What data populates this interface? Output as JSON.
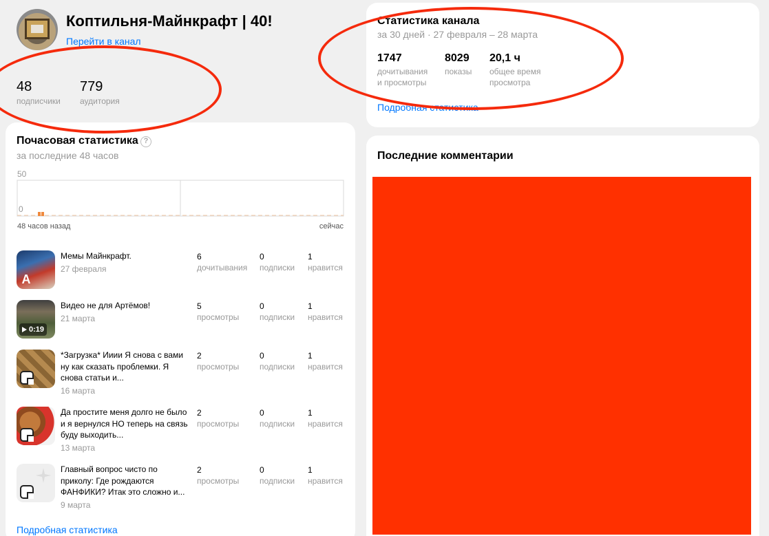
{
  "colors": {
    "accent": "#0077ff",
    "redaction": "#ff3000",
    "annotation": "#f52a0c",
    "chart_bar": "#f08a3e"
  },
  "header": {
    "channel_name": "Коптильня-Майнкрафт | 40!",
    "channel_link": "Перейти в канал",
    "subscribers": {
      "value": "48",
      "label": "подписчики"
    },
    "audience": {
      "value": "779",
      "label": "аудитория"
    }
  },
  "channel_stats": {
    "title": "Статистика канала",
    "period": "за 30 дней · 27 февраля – 28 марта",
    "items": [
      {
        "value": "1747",
        "label_line1": "дочитывания",
        "label_line2": "и просмотры"
      },
      {
        "value": "8029",
        "label_line1": "показы",
        "label_line2": ""
      },
      {
        "value": "20,1 ч",
        "label_line1": "общее время",
        "label_line2": "просмотра"
      }
    ],
    "link": "Подробная статистика"
  },
  "hourly": {
    "title": "Почасовая статистика",
    "help_icon": "question-circle-icon",
    "subtitle": "за последние 48 часов",
    "link": "Подробная статистика",
    "chart_data": {
      "type": "bar",
      "ylim": [
        0,
        50
      ],
      "y_tick_labels": [
        "50",
        "0"
      ],
      "x_tick_labels": [
        "48 часов назад",
        "сейчас"
      ],
      "values": [
        0,
        0,
        0,
        0,
        0,
        0,
        0,
        0,
        0,
        0,
        0,
        0,
        1,
        1,
        0,
        0,
        0,
        0,
        0,
        0,
        0,
        0,
        0,
        0,
        0,
        0,
        0,
        0,
        0,
        0,
        0,
        0,
        0,
        0,
        0,
        0,
        0,
        0,
        0,
        0,
        0,
        0,
        0,
        0,
        0,
        0,
        0,
        0
      ],
      "grid": true
    },
    "posts": [
      {
        "title": "Мемы Майнкрафт.",
        "date": "27 февраля",
        "metrics": [
          {
            "v": "6",
            "l": "дочитывания"
          },
          {
            "v": "0",
            "l": "подписки"
          },
          {
            "v": "1",
            "l": "нравится"
          }
        ],
        "badge": "A"
      },
      {
        "title": "Видео не для Артёмов!",
        "date": "21 марта",
        "metrics": [
          {
            "v": "5",
            "l": "просмотры"
          },
          {
            "v": "0",
            "l": "подписки"
          },
          {
            "v": "1",
            "l": "нравится"
          }
        ],
        "badge": "0:19"
      },
      {
        "title": "*Загрузка* Ииии Я снова с вами ну как сказать проблемки. Я снова статьи и...",
        "date": "16 марта",
        "metrics": [
          {
            "v": "2",
            "l": "просмотры"
          },
          {
            "v": "0",
            "l": "подписки"
          },
          {
            "v": "1",
            "l": "нравится"
          }
        ],
        "badge": ""
      },
      {
        "title": "Да простите меня долго не было и я вернулся НО теперь на связь буду выходить...",
        "date": "13 марта",
        "metrics": [
          {
            "v": "2",
            "l": "просмотры"
          },
          {
            "v": "0",
            "l": "подписки"
          },
          {
            "v": "1",
            "l": "нравится"
          }
        ],
        "badge": ""
      },
      {
        "title": "Главный вопрос чисто по приколу: Где рождаются ФАНФИКИ? Итак это сложно и...",
        "date": "9 марта",
        "metrics": [
          {
            "v": "2",
            "l": "просмотры"
          },
          {
            "v": "0",
            "l": "подписки"
          },
          {
            "v": "1",
            "l": "нравится"
          }
        ],
        "badge": ""
      }
    ]
  },
  "comments": {
    "title": "Последние комментарии"
  }
}
